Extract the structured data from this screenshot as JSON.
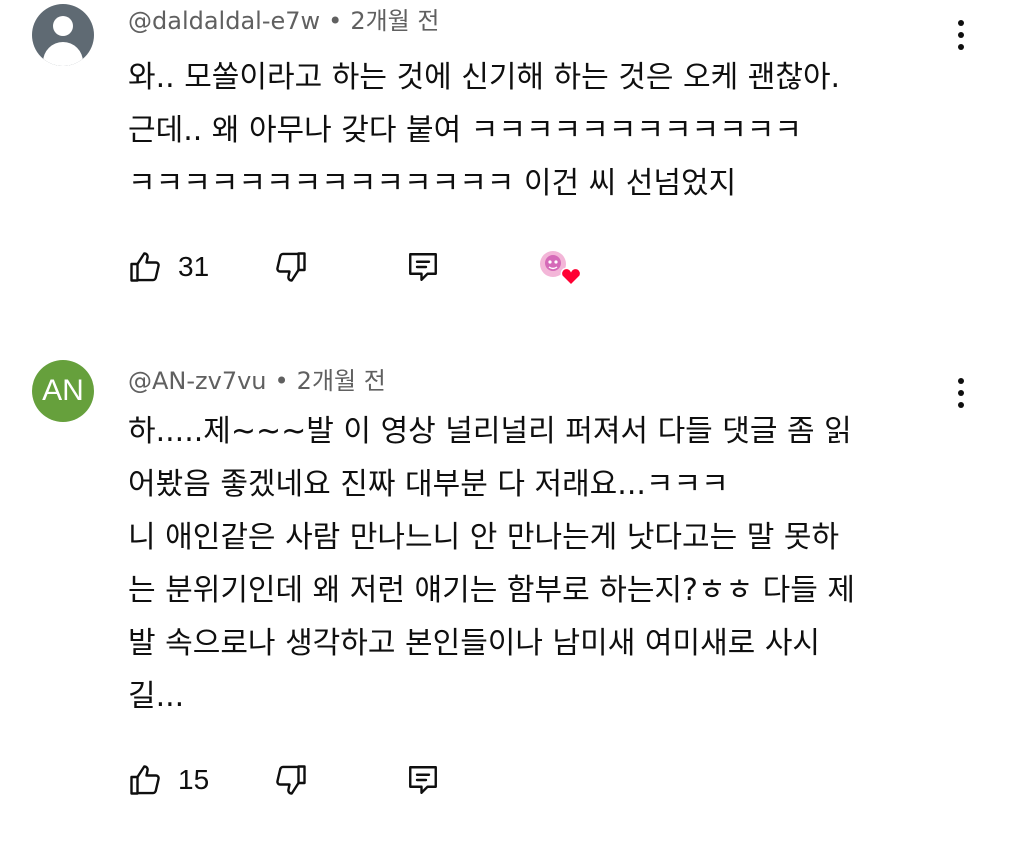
{
  "comments": [
    {
      "handle": "@daldaldal-e7w",
      "time": "2개월 전",
      "text": "와.. 모쏠이라고 하는 것에 신기해 하는 것은 오케 괜찮아.\n근데.. 왜 아무나 갖다 붙여 ㅋㅋㅋㅋㅋㅋㅋㅋㅋㅋㅋㅋ\nㅋㅋㅋㅋㅋㅋㅋㅋㅋㅋㅋㅋㅋㅋ 이건 씨 선넘었지",
      "likes": "31",
      "avatar_type": "default-silhouette",
      "has_creator_heart": true
    },
    {
      "handle": "@AN-zv7vu",
      "time": "2개월 전",
      "text": "하.....제~~~발 이 영상 널리널리 퍼져서 다들 댓글 좀 읽\n어봤음 좋겠네요 진짜 대부분 다 저래요...ㅋㅋㅋ\n니 애인같은 사람 만나느니 안 만나는게 낫다고는 말 못하\n는 분위기인데 왜 저런 얘기는 함부로 하는지?ㅎㅎ 다들 제\n발 속으로나 생각하고 본인들이나 남미새 여미새로 사시\n길...",
      "likes": "15",
      "avatar_letters": "AN",
      "has_creator_heart": false
    }
  ],
  "meta_separator": "•",
  "icons": {
    "like": "thumbs-up-icon",
    "dislike": "thumbs-down-icon",
    "reply": "reply-icon",
    "menu": "more-vertical-icon",
    "heart": "creator-heart-icon"
  },
  "colors": {
    "secondary_text": "#606060",
    "avatar_default_bg": "#5f6a73",
    "avatar_an_bg": "#66a03c",
    "heart_red": "#ff0033"
  }
}
